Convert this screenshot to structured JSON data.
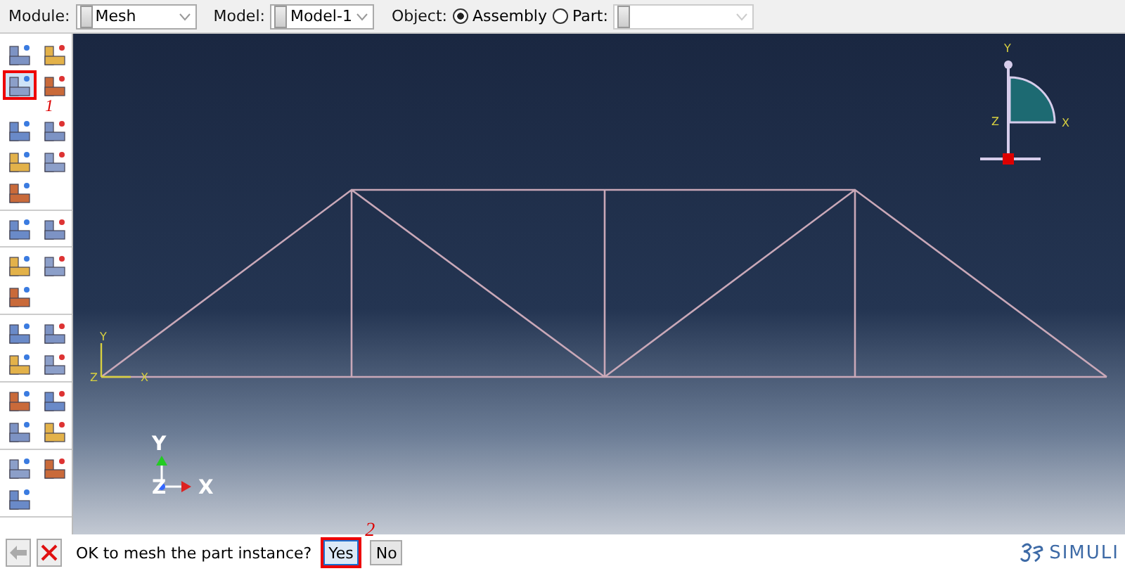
{
  "context_bar": {
    "module": {
      "label": "Module:",
      "value": "Mesh"
    },
    "model": {
      "label": "Model:",
      "value": "Model-1"
    },
    "object": {
      "label": "Object:",
      "options": [
        {
          "label": "Assembly",
          "selected": true
        },
        {
          "label": "Part:",
          "selected": false
        }
      ]
    }
  },
  "toolbox": {
    "groups": [
      [
        {
          "highlighted": false
        },
        {
          "highlighted": false
        },
        {
          "highlighted": true
        },
        {
          "highlighted": false
        },
        {
          "highlighted": false
        },
        {
          "highlighted": false
        },
        {
          "highlighted": false
        },
        {
          "highlighted": false
        },
        {
          "highlighted": false
        }
      ],
      [
        {
          "highlighted": false
        },
        {
          "highlighted": false
        }
      ],
      [
        {
          "highlighted": false
        },
        {
          "highlighted": false
        },
        {
          "highlighted": false
        }
      ],
      [
        {
          "highlighted": false
        },
        {
          "highlighted": false
        },
        {
          "highlighted": false
        },
        {
          "highlighted": false
        }
      ],
      [
        {
          "highlighted": false
        },
        {
          "highlighted": false
        },
        {
          "highlighted": false
        },
        {
          "highlighted": false
        }
      ],
      [
        {
          "highlighted": false
        },
        {
          "highlighted": false
        },
        {
          "highlighted": false
        }
      ]
    ]
  },
  "annotations": [
    {
      "label": "1"
    },
    {
      "label": "2"
    }
  ],
  "viewport": {
    "view_triad": {
      "y": "Y",
      "x": "X",
      "z": "Z"
    },
    "origin_triad": {
      "y": "Y",
      "z": "Z",
      "x": "X"
    },
    "global_triad": {
      "y": "Y",
      "x": "X",
      "z": "Z"
    }
  },
  "prompt": {
    "text": "OK to mesh the part instance?",
    "buttons": [
      {
        "label": "Yes",
        "highlighted": true
      },
      {
        "label": "No",
        "highlighted": false
      }
    ]
  },
  "brand": {
    "text": "SIMULI"
  }
}
